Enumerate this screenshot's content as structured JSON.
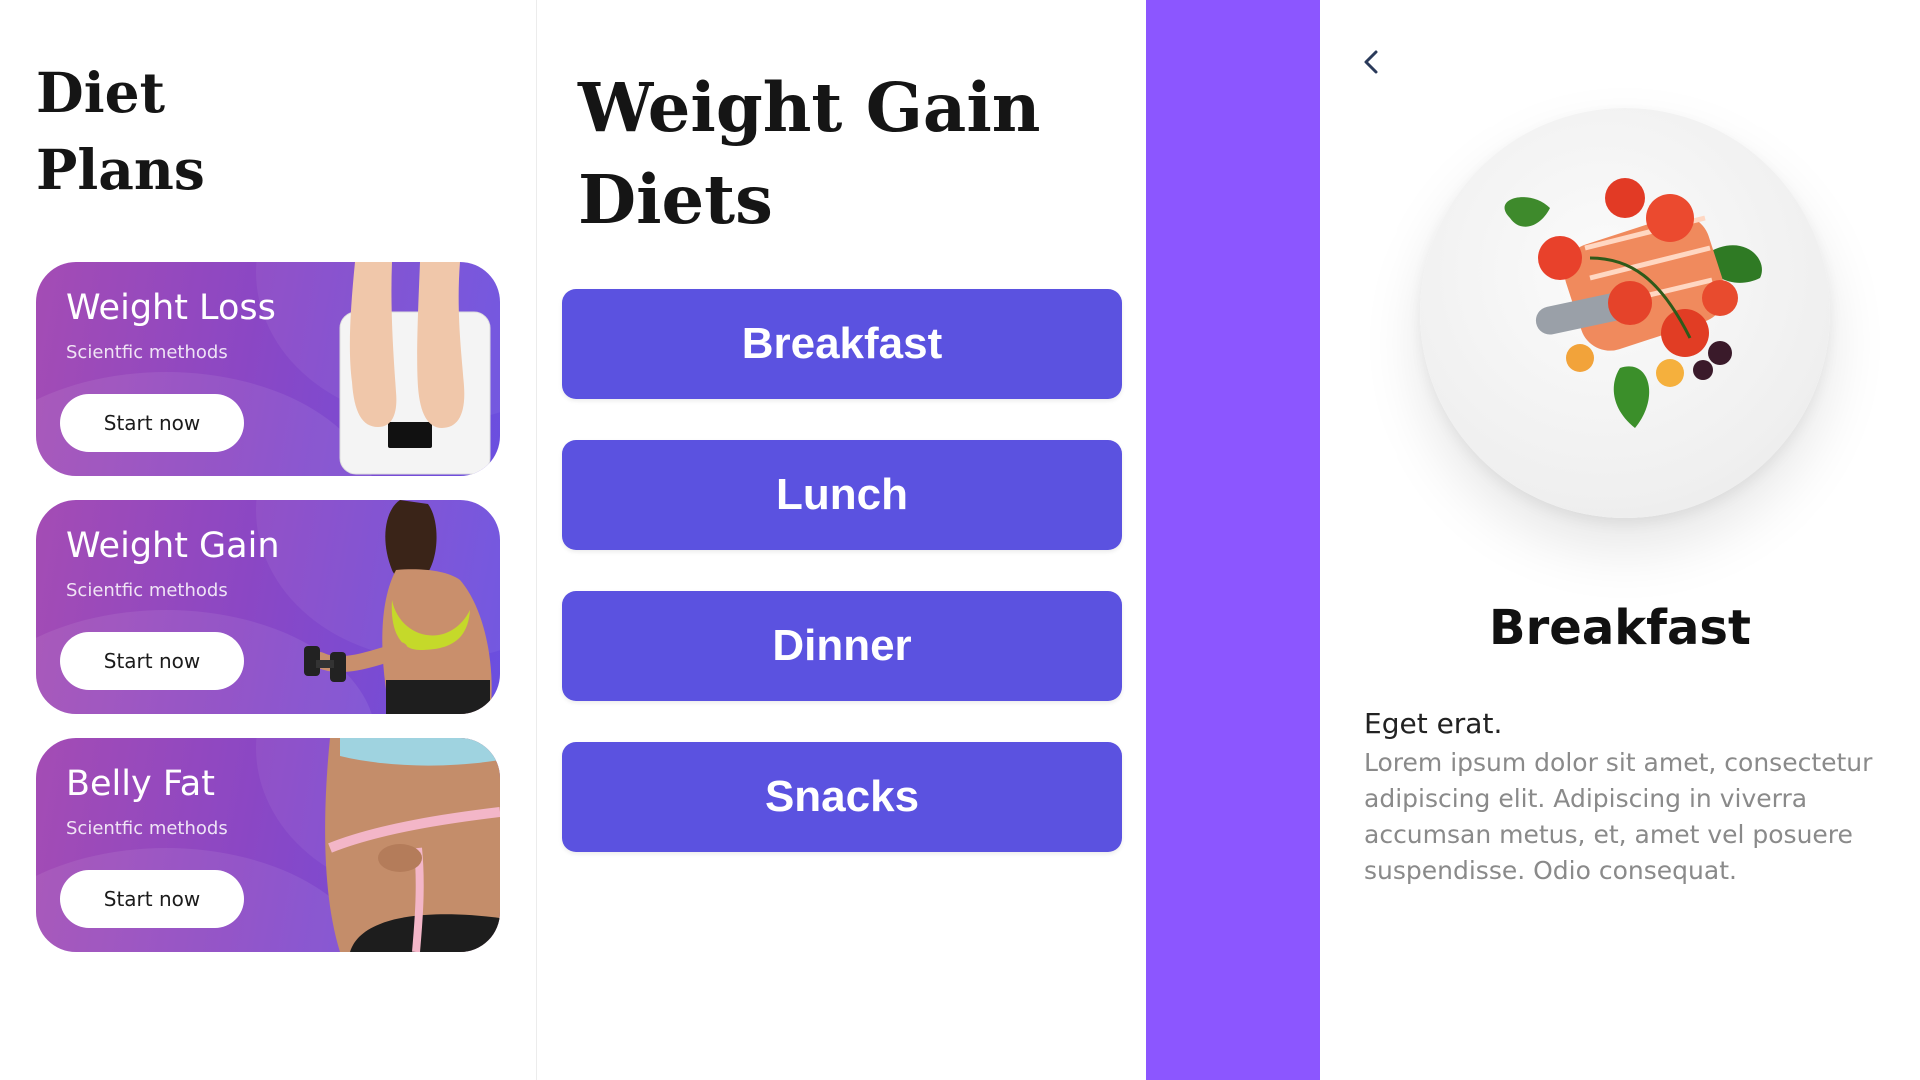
{
  "plans_panel": {
    "title": "Diet\nPlans",
    "cards": [
      {
        "name": "Weight Loss",
        "subtitle": "Scientfic methods",
        "button": "Start now",
        "image": "scale-feet"
      },
      {
        "name": "Weight Gain",
        "subtitle": "Scientfic methods",
        "button": "Start now",
        "image": "woman-dumbbell"
      },
      {
        "name": "Belly Fat",
        "subtitle": "Scientfic methods",
        "button": "Start now",
        "image": "waist-measuring-tape"
      }
    ]
  },
  "diets_panel": {
    "title": "Weight Gain\nDiets",
    "meals": [
      "Breakfast",
      "Lunch",
      "Dinner",
      "Snacks"
    ]
  },
  "detail_panel": {
    "back_icon": "chevron-left-icon",
    "image": "salmon-tomato-plate",
    "title": "Breakfast",
    "subtitle": "Eget erat.",
    "body": "Lorem ipsum dolor sit amet, consectetur adipiscing elit. Adipiscing in viverra accumsan metus, et, amet vel posuere suspendisse. Odio consequat."
  },
  "colors": {
    "meal_button": "#5b52e0",
    "accent_strip": "#8c56ff",
    "card_gradient_start": "#a44cb4",
    "card_gradient_end": "#6a4fe0"
  }
}
